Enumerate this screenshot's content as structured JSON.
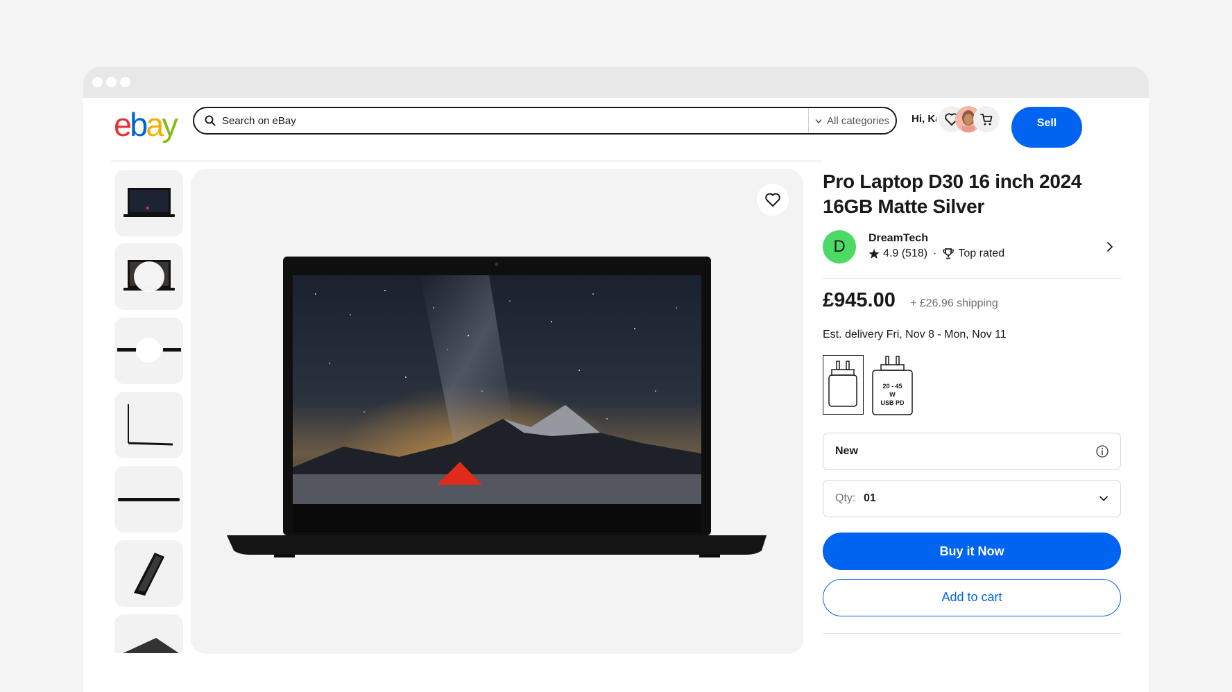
{
  "header": {
    "logo_letters": [
      "e",
      "b",
      "a",
      "y"
    ],
    "logo_colors": [
      "#e53238",
      "#0064d2",
      "#f5af02",
      "#86b817"
    ],
    "search_placeholder": "Search on eBay",
    "category_label": "All categories",
    "greeting": "Hi, Ka",
    "sell_label": "Sell",
    "icons": [
      "search-icon",
      "chevron-down-icon",
      "heart-icon",
      "avatar",
      "cart-icon"
    ]
  },
  "gallery": {
    "thumbnails": [
      "laptop-front",
      "video",
      "360-view",
      "side-profile",
      "closed-edge",
      "angled-view",
      "back-lid"
    ],
    "main_image": "laptop-front-starry-night"
  },
  "product": {
    "title": "Pro Laptop D30 16 inch 2024 16GB Matte Silver",
    "seller": {
      "initial": "D",
      "name": "DreamTech",
      "rating": "4.9 (518)",
      "separator": "·",
      "badge": "Top rated"
    },
    "price": "£945.00",
    "shipping": "+ £26.96 shipping",
    "delivery": "Est. delivery Fri, Nov 8 - Mon, Nov 11",
    "charger_label_line1": "20 - 45",
    "charger_label_line2": "W",
    "charger_label_line3": "USB PD",
    "condition": "New",
    "qty_label": "Qty:",
    "qty_value": "01",
    "buy_now_label": "Buy it Now",
    "add_to_cart_label": "Add to cart"
  },
  "colors": {
    "accent_blue": "#0064f0",
    "seller_avatar_green": "#4cd964"
  }
}
